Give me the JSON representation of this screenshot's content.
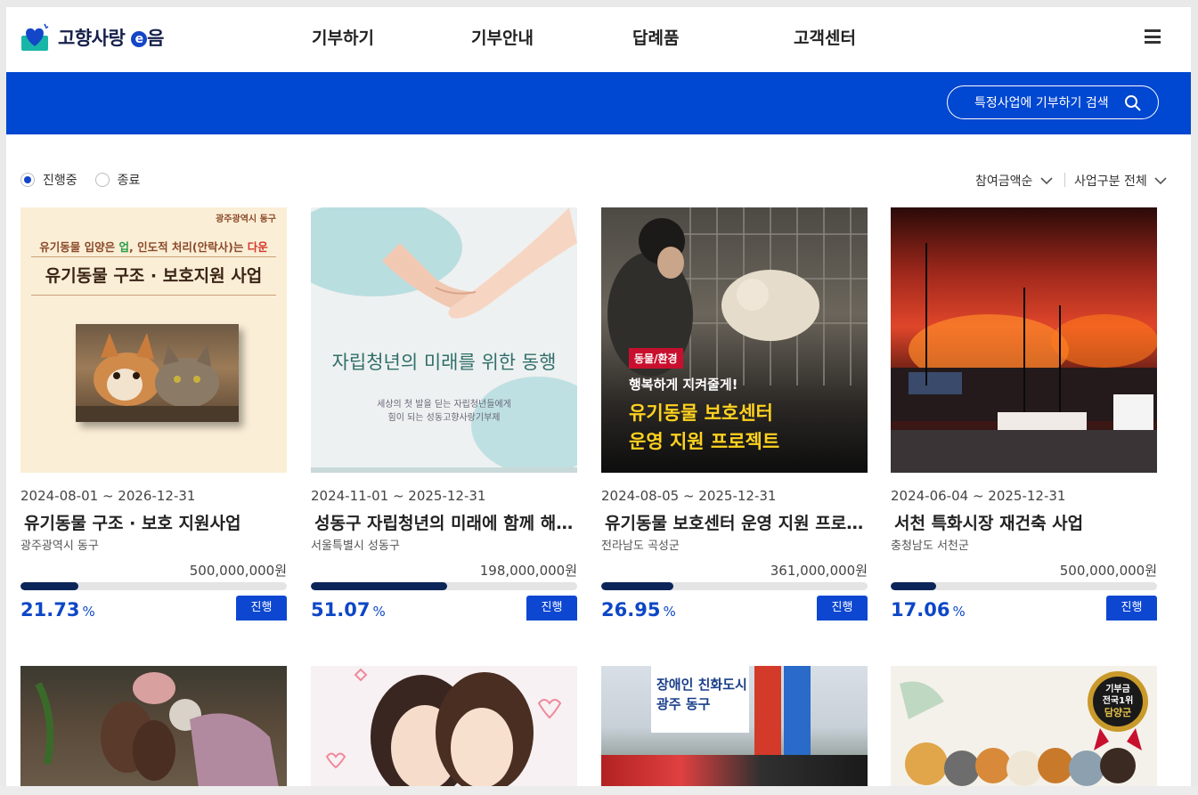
{
  "logo": {
    "text": "고향사랑",
    "e": "e",
    "suffix": "음"
  },
  "nav": [
    "기부하기",
    "기부안내",
    "답례품",
    "고객센터"
  ],
  "search": {
    "label": "특정사업에 기부하기 검색"
  },
  "filters": {
    "ongoing": "진행중",
    "ended": "종료"
  },
  "sort": {
    "order": "참여금액순",
    "category": "사업구분 전체"
  },
  "cards": [
    {
      "period": "2024-08-01 ~ 2026-12-31",
      "title": "유기동물 구조 · 보호 지원사업",
      "region": "광주광역시 동구",
      "goal": "500,000,000원",
      "percent": "21.73",
      "percent_unit": "%",
      "progress": 21.73,
      "status": "진행",
      "image_text": {
        "org": "광주광역시 동구",
        "tagline_a": "유기동물 입양은 ",
        "tagline_b": "업",
        "tagline_c": ", 인도적 처리(안락사)는 ",
        "tagline_d": "다운",
        "headline": "유기동물 구조 · 보호지원 사업"
      }
    },
    {
      "period": "2024-11-01 ~ 2025-12-31",
      "title": "성동구 자립청년의 미래에 함께 해주세요",
      "region": "서울특별시 성동구",
      "goal": "198,000,000원",
      "percent": "51.07",
      "percent_unit": "%",
      "progress": 51.07,
      "status": "진행",
      "image_text": {
        "headline": "자립청년의 미래를 위한 동행",
        "sub1": "세상의 첫 발을 딛는 자립청년들에게",
        "sub2": "힘이 되는 성동고향사랑기부제"
      }
    },
    {
      "period": "2024-08-05 ~ 2025-12-31",
      "title": "유기동물 보호센터 운영 지원 프로젝트",
      "region": "전라남도 곡성군",
      "goal": "361,000,000원",
      "percent": "26.95",
      "percent_unit": "%",
      "progress": 26.95,
      "status": "진행",
      "image_text": {
        "tag": "동물/환경",
        "sub": "행복하게 지켜줄게!",
        "line1": "유기동물 보호센터",
        "line2": "운영 지원 프로젝트"
      }
    },
    {
      "period": "2024-06-04 ~ 2025-12-31",
      "title": "서천 특화시장 재건축 사업",
      "region": "충청남도 서천군",
      "goal": "500,000,000원",
      "percent": "17.06",
      "percent_unit": "%",
      "progress": 17.06,
      "status": "진행"
    }
  ],
  "second_row": {
    "card3_banner1": "장애인 친화도시",
    "card3_banner2": "광주 동구",
    "card4_badge1": "기부금",
    "card4_badge2": "전국1위",
    "card4_badge3": "담양군"
  },
  "colors": {
    "brand_blue": "#0047d1",
    "progress": "#0c2558",
    "percent": "#0d47c6"
  }
}
